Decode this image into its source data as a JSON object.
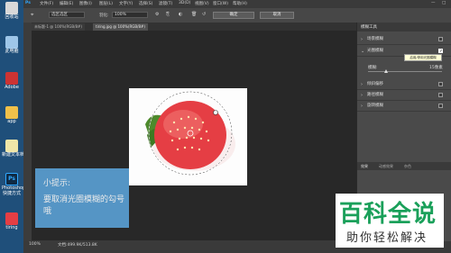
{
  "desktop": {
    "icons": [
      {
        "label": "回收站"
      },
      {
        "label": "此电脑"
      },
      {
        "label": "Adobe"
      },
      {
        "label": "app"
      },
      {
        "label": "新建文本档"
      },
      {
        "label": "Photoshop\n快捷方式"
      },
      {
        "label": "tiring"
      }
    ]
  },
  "ps": {
    "menubar": {
      "items": [
        "文件(F)",
        "编辑(E)",
        "图像(I)",
        "图层(L)",
        "文字(Y)",
        "选择(S)",
        "滤镜(T)",
        "3D(D)",
        "视图(V)",
        "窗口(W)",
        "帮助(H)"
      ]
    },
    "options": {
      "selection_field": "选区选区",
      "feather_label": "羽化:",
      "feather_value": "100%",
      "ok_label": "确定",
      "cancel_label": "取消"
    },
    "tabs": [
      {
        "label": "未标题-1 @ 100%(RGB/8#)"
      },
      {
        "label": "tiring.jpg @ 100%(RGB/8#)"
      }
    ],
    "status": {
      "zoom": "100%",
      "doc": "文档:499.9K/513.8K"
    }
  },
  "panel": {
    "title": "模糊工具",
    "rows": [
      {
        "label": "场景模糊"
      },
      {
        "label": "光圈模糊"
      },
      {
        "label": "倾斜偏移"
      },
      {
        "label": "路径模糊"
      },
      {
        "label": "旋转模糊"
      }
    ],
    "tooltip": "启用/停用光圈模糊",
    "slider_label": "模糊:",
    "slider_value": "15像素",
    "bottom_tabs": [
      "效果",
      "动感效果",
      "杂色"
    ]
  },
  "tip": {
    "title": "小提示:",
    "body": "要取消光圈模糊的勾号哦"
  },
  "watermark": {
    "main": "百科全说",
    "sub": "助你轻松解决"
  },
  "colors": {
    "accent": "#5aa1d6",
    "watermark_green": "#1aa05a",
    "strawberry": "#e53e44"
  }
}
